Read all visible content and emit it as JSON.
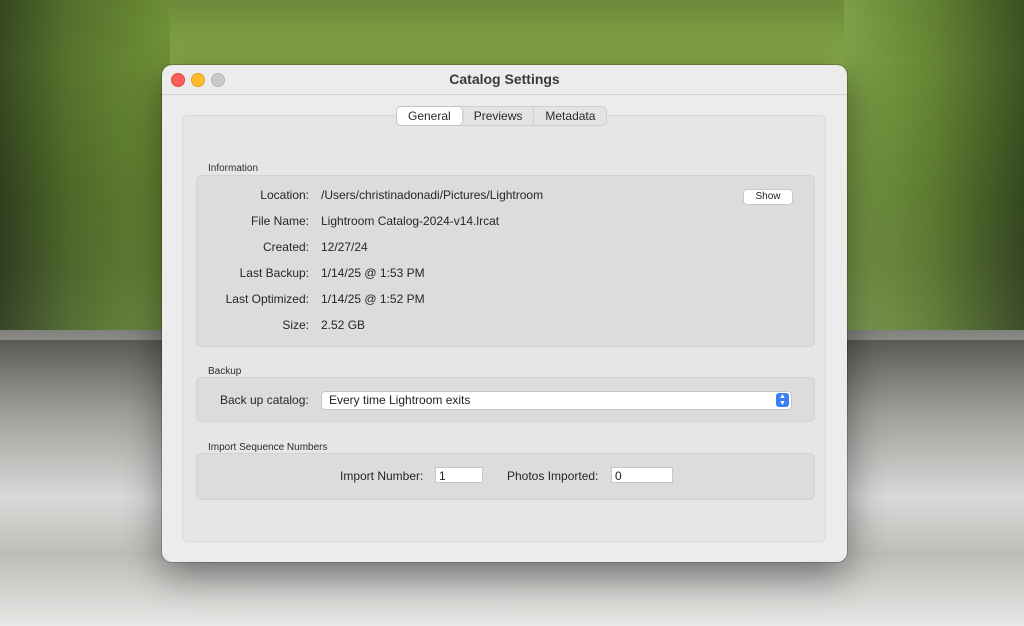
{
  "window": {
    "title": "Catalog Settings"
  },
  "tabs": [
    {
      "label": "General",
      "active": true
    },
    {
      "label": "Previews",
      "active": false
    },
    {
      "label": "Metadata",
      "active": false
    }
  ],
  "information": {
    "heading": "Information",
    "show_button": "Show",
    "rows": [
      {
        "label": "Location:",
        "value": "/Users/christinadonadi/Pictures/Lightroom"
      },
      {
        "label": "File Name:",
        "value": "Lightroom Catalog-2024-v14.lrcat"
      },
      {
        "label": "Created:",
        "value": "12/27/24"
      },
      {
        "label": "Last Backup:",
        "value": "1/14/25 @ 1:53 PM"
      },
      {
        "label": "Last Optimized:",
        "value": "1/14/25 @ 1:52 PM"
      },
      {
        "label": "Size:",
        "value": "2.52 GB"
      }
    ]
  },
  "backup": {
    "heading": "Backup",
    "label": "Back up catalog:",
    "selected": "Every time Lightroom exits"
  },
  "import_sequence": {
    "heading": "Import Sequence Numbers",
    "import_number_label": "Import Number:",
    "import_number_value": "1",
    "photos_imported_label": "Photos Imported:",
    "photos_imported_value": "0"
  },
  "colors": {
    "close": "#fe5f57",
    "minimize": "#febc2e",
    "zoom_disabled": "#c9c9c9",
    "select_accent": "#3e7ef5"
  }
}
